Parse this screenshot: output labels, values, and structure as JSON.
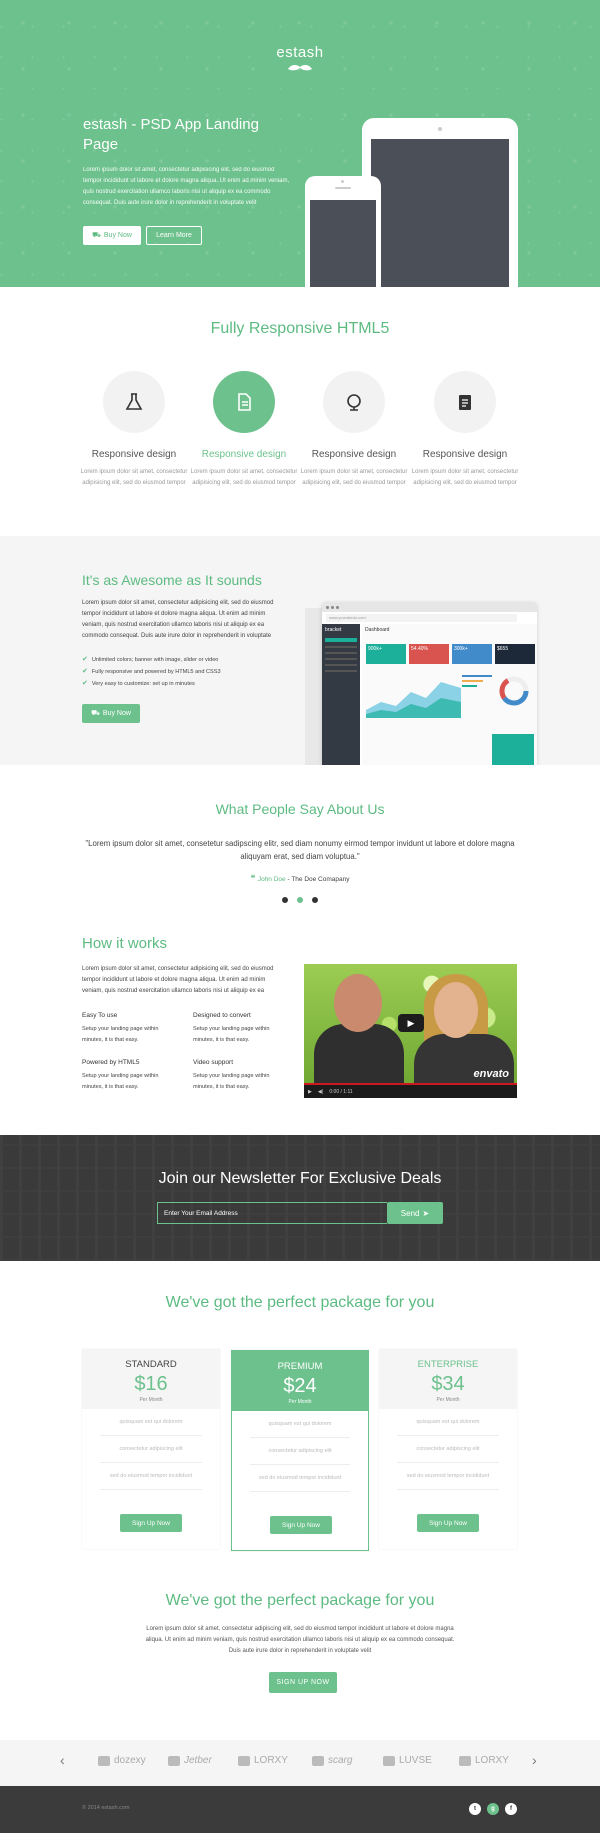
{
  "hero": {
    "logo": "estash",
    "title": "estash - PSD App Landing Page",
    "body": "Lorem ipsum dolor sit amet, consectetur adipisicing elit, sed do eiusmod tempor incididunt ut labore et dolore magna aliqua. Ut enim ad minim veniam, quis nostrud exercitation ullamco laboris nisi ut aliquip ex ea commodo consequat. Duis aute irure dolor in reprehenderit in voluptate velit",
    "buy_label": "Buy Now",
    "learn_label": "Learn More",
    "accent": "#6cc18c"
  },
  "features": {
    "title": "Fully Responsive HTML5",
    "items": [
      {
        "icon": "flask-icon",
        "title": "Responsive design",
        "text": "Lorem ipsum dolor sit amet, consectetur adipisicing elit, sed do eiusmod tempor"
      },
      {
        "icon": "document-icon",
        "title": "Responsive design",
        "text": "Lorem ipsum dolor sit amet, consectetur adipisicing elit, sed do eiusmod tempor"
      },
      {
        "icon": "globe-icon",
        "title": "Responsive design",
        "text": "Lorem ipsum dolor sit amet, consectetur adipisicing elit, sed do eiusmod tempor"
      },
      {
        "icon": "clipboard-icon",
        "title": "Responsive design",
        "text": "Lorem ipsum dolor sit amet, consectetur adipisicing elit, sed do eiusmod tempor"
      }
    ]
  },
  "awesome": {
    "title": "It's as Awesome as It sounds",
    "body": "Lorem ipsum dolor sit amet, consectetur adipisicing elit, sed do eiusmod tempor incididunt ut labore et dolore magna aliqua. Ut enim ad minim veniam, quis nostrud exercitation ullamco laboris nisi ut aliquip ex ea commodo consequat. Duis aute irure dolor in reprehenderit in voluptate",
    "list": [
      "Unlimited colors; banner with image, slider or video",
      "Fully responsive and powered by HTML5 and CSS3",
      "Very easy to customize: set up in minutes"
    ],
    "buy_label": "Buy Now",
    "dash_url": "www.yoursitedo.com",
    "dash_brand": "bracket",
    "dash_title": "Dashboard",
    "tiles": [
      "900k+",
      "54.40%",
      "300k+",
      "$655"
    ]
  },
  "testimonial": {
    "title": "What People Say About Us",
    "quote": "\"Lorem ipsum dolor sit amet, consetetur sadipscing elitr, sed diam nonumy eirmod tempor invidunt ut labore et dolore magna aliquyam erat, sed diam voluptua.\"",
    "author": "John Doe",
    "company": " - The Doe Comapany"
  },
  "how": {
    "title": "How it works",
    "body": "Lorem ipsum dolor sit amet, consectetur adipisicing elit, sed do eiusmod tempor incididunt ut labore et dolore magna aliqua. Ut enim ad minim veniam, quis nostrud exercitation ullamco laboris nisi ut aliquip ex ea",
    "items": [
      {
        "title": "Easy To use",
        "text": "Setup your landing page within minutes, it is that easy."
      },
      {
        "title": "Designed to convert",
        "text": "Setup your landing page within minutes, it is that easy."
      },
      {
        "title": "Powered by HTML5",
        "text": "Setup your landing page within minutes, it is that easy."
      },
      {
        "title": "Video support",
        "text": "Setup your landing page within minutes, it is that easy."
      }
    ],
    "video_brand": "envato",
    "video_time": "0:00 / 1:11"
  },
  "newsletter": {
    "title": "Join our Newsletter For Exclusive Deals",
    "placeholder": "Enter Your Email Address",
    "send_label": "Send"
  },
  "pricing": {
    "title": "We've got the perfect package for you",
    "plans": [
      {
        "name": "STANDARD",
        "price": "$16",
        "per": "Per Month",
        "rows": [
          "quisquam est qui dolorem",
          "consectetur adipiscing elit",
          "sed do eiusmod tempor incididunt"
        ],
        "cta": "Sign Up Now"
      },
      {
        "name": "PREMIUM",
        "price": "$24",
        "per": "Per Month",
        "rows": [
          "quisquam est qui dolorem",
          "consectetur adipiscing elit",
          "sed do eiusmod tempor incididunt"
        ],
        "cta": "Sign Up Now"
      },
      {
        "name": "ENTERPRISE",
        "price": "$34",
        "per": "Per Month",
        "rows": [
          "quisquam est qui dolorem",
          "consectetur adipiscing elit",
          "sed do eiusmod tempor incididunt"
        ],
        "cta": "Sign Up Now"
      }
    ]
  },
  "cta": {
    "title": "We've got the perfect package for you",
    "body": "Lorem ipsum dolor sit amet, consectetur adipiscing elit, sed do eiusmod tempor incididunt ut labore et dolore magna aliqua. Ut enim ad minim veniam, quis nostrud exercitation ullamco laboris nisi ut aliquip ex ea commodo consequat. Duis aute irure dolor in reprehenderit in voluptate velit",
    "button": "SIGN UP NOW"
  },
  "logos": [
    "dozexy",
    "Jetber",
    "LORXY",
    "scarg",
    "LUVSE",
    "LORXY"
  ],
  "footer": {
    "copy": "© 2014 estash.com",
    "social": [
      "twitter-icon",
      "google-plus-icon",
      "facebook-icon"
    ]
  }
}
